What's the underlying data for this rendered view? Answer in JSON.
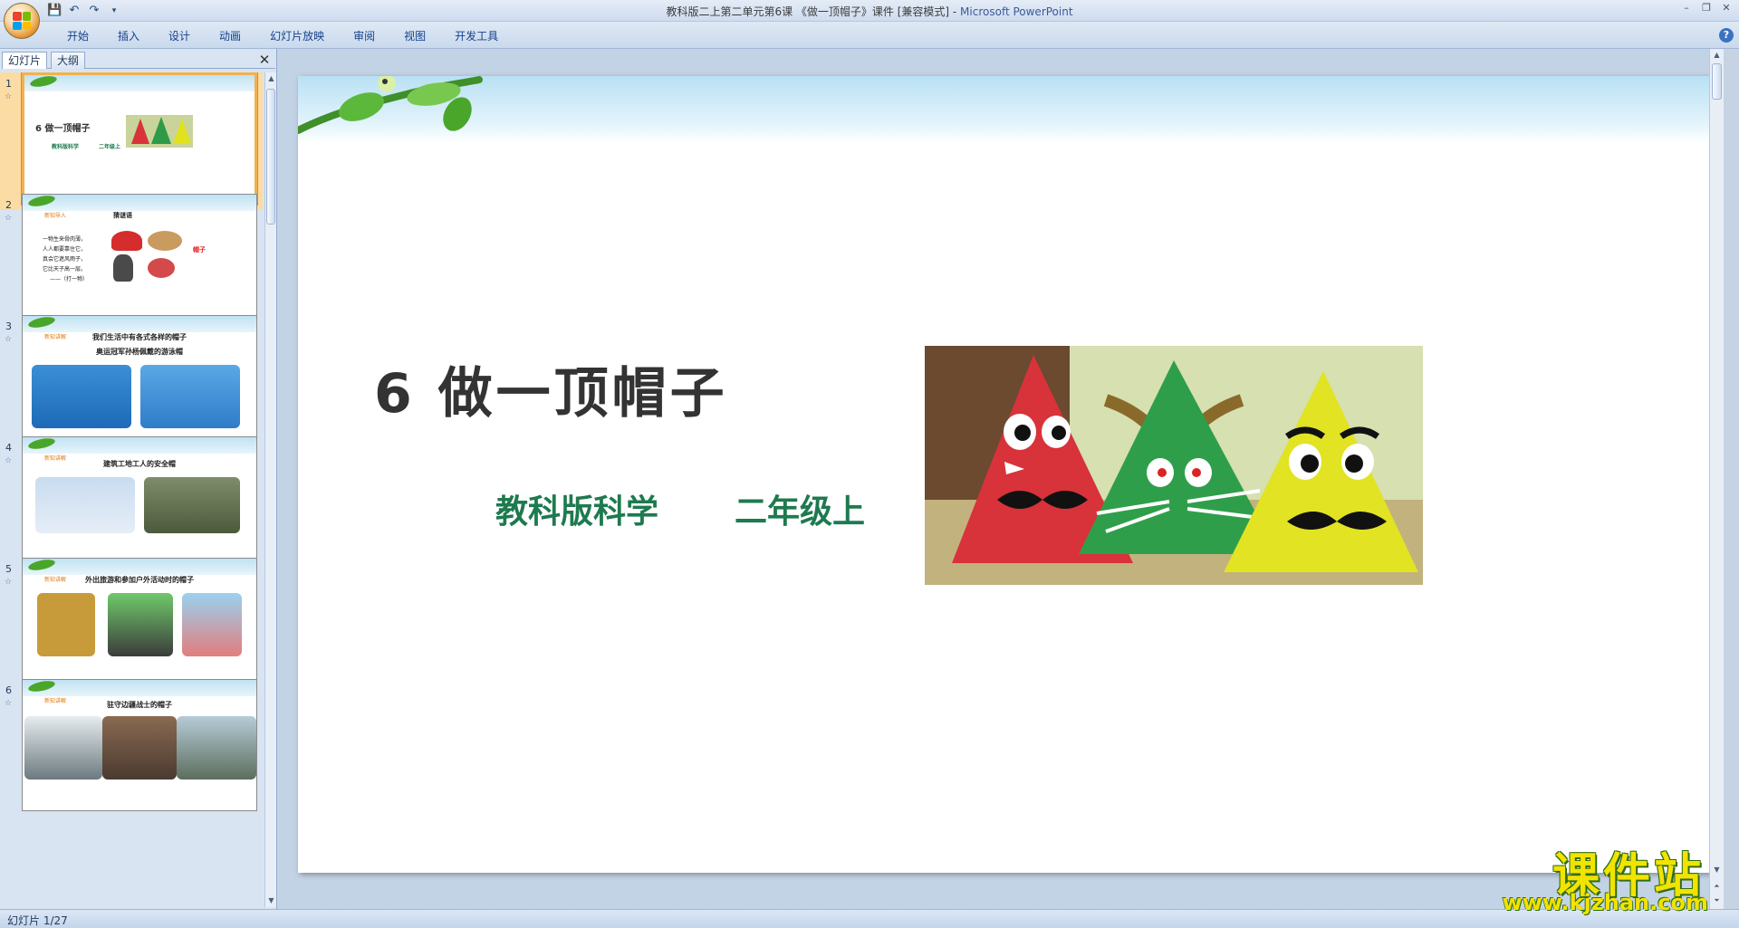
{
  "window": {
    "title": "教科版二上第二单元第6课  《做一顶帽子》课件 [兼容模式] - ",
    "app_name": "Microsoft PowerPoint"
  },
  "ribbon": {
    "tabs": [
      "开始",
      "插入",
      "设计",
      "动画",
      "幻灯片放映",
      "审阅",
      "视图",
      "开发工具"
    ]
  },
  "left_pane": {
    "tab_slides": "幻灯片",
    "tab_outline": "大纲"
  },
  "thumbnails": [
    {
      "number": "1",
      "title": "6  做一顶帽子",
      "line1": "教科版科学",
      "line2": "二年级上"
    },
    {
      "number": "2",
      "tag": "新知导入",
      "heading": "猜谜语",
      "riddle": [
        "一物生来骨肉薄，",
        "人人都要靠住它，",
        "真会它遮风雨子，",
        "它比天子高一层。",
        "——（打一物）"
      ],
      "answer": "帽子"
    },
    {
      "number": "3",
      "tag": "新知讲解",
      "heading": "我们生活中有各式各样的帽子",
      "sub": "奥运冠军孙杨佩戴的游泳帽"
    },
    {
      "number": "4",
      "tag": "新知讲解",
      "heading": "建筑工地工人的安全帽"
    },
    {
      "number": "5",
      "tag": "新知讲解",
      "heading": "外出旅游和参加户外活动时的帽子"
    },
    {
      "number": "6",
      "tag": "新知讲解",
      "heading": "驻守边疆战士的帽子"
    }
  ],
  "slide": {
    "title": "6  做一顶帽子",
    "subject": "教科版科学",
    "grade": "二年级上"
  },
  "status": {
    "slide_info": "幻灯片 1/27"
  },
  "watermark": {
    "name": "课件站",
    "url": "www.kjzhan.com"
  }
}
